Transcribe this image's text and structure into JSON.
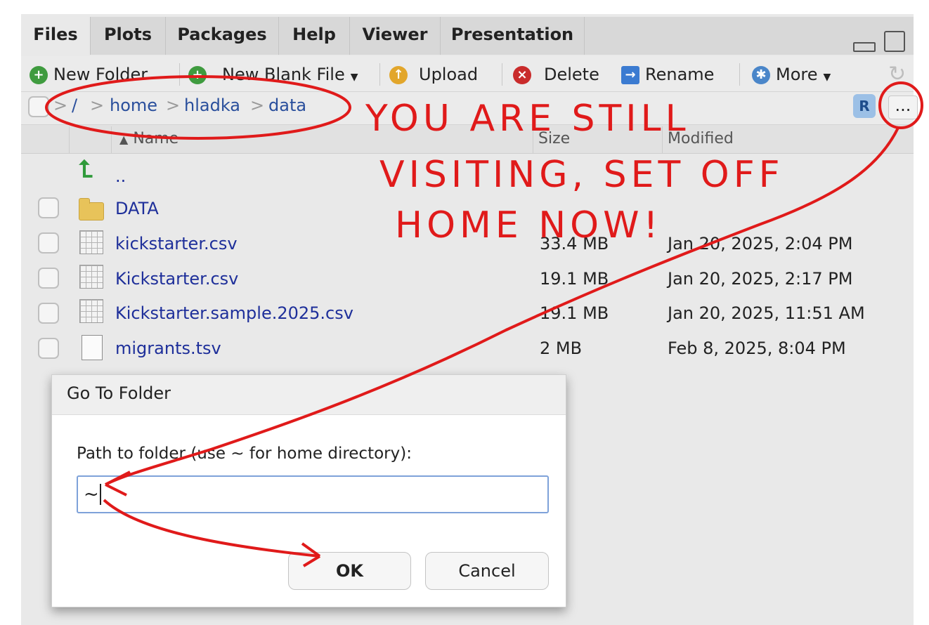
{
  "tabs": [
    {
      "label": "Files",
      "active": true
    },
    {
      "label": "Plots",
      "active": false
    },
    {
      "label": "Packages",
      "active": false
    },
    {
      "label": "Help",
      "active": false
    },
    {
      "label": "Viewer",
      "active": false
    },
    {
      "label": "Presentation",
      "active": false
    }
  ],
  "toolbar": {
    "new_folder": "New Folder",
    "new_blank_file": "New Blank File",
    "upload": "Upload",
    "delete": "Delete",
    "rename": "Rename",
    "more": "More"
  },
  "breadcrumb": {
    "root": "/",
    "items": [
      "home",
      "hladka",
      "data"
    ],
    "more_button": "..."
  },
  "columns": {
    "name": "Name",
    "size": "Size",
    "modified": "Modified"
  },
  "files": [
    {
      "name": "..",
      "size": "",
      "modified": "",
      "type": "parent"
    },
    {
      "name": "DATA",
      "size": "",
      "modified": "",
      "type": "folder"
    },
    {
      "name": "kickstarter.csv",
      "size": "33.4 MB",
      "modified": "Jan 20, 2025, 2:04 PM",
      "type": "csv"
    },
    {
      "name": "Kickstarter.csv",
      "size": "19.1 MB",
      "modified": "Jan 20, 2025, 2:17 PM",
      "type": "csv"
    },
    {
      "name": "Kickstarter.sample.2025.csv",
      "size": "19.1 MB",
      "modified": "Jan 20, 2025, 11:51 AM",
      "type": "csv"
    },
    {
      "name": "migrants.tsv",
      "size": "2 MB",
      "modified": "Feb 8, 2025, 8:04 PM",
      "type": "tsv"
    }
  ],
  "dialog": {
    "title": "Go To Folder",
    "label": "Path to folder (use ~ for home directory):",
    "input_value": "~",
    "ok": "OK",
    "cancel": "Cancel"
  },
  "annotation": {
    "line1": "YOU ARE STILL",
    "line2": "VISITING, SET OFF",
    "line3": "HOME NOW!"
  },
  "colors": {
    "link": "#1e2f9a",
    "annotation": "#e01a1a"
  }
}
